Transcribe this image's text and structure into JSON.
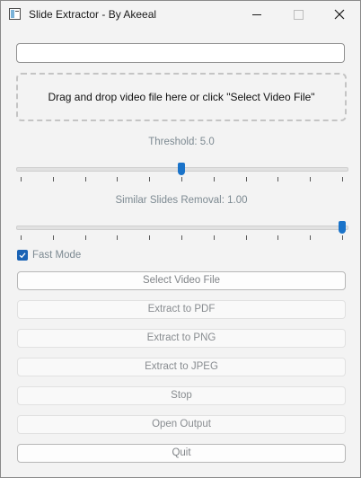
{
  "window": {
    "title": "Slide Extractor - By Akeeal",
    "app_icon": "app-window-icon"
  },
  "path_input": {
    "value": "",
    "placeholder": ""
  },
  "drop_zone": {
    "text": "Drag and drop video file here or click \"Select Video File\""
  },
  "threshold": {
    "label": "Threshold: 5.0",
    "value": 5.0,
    "min": 0,
    "max": 10,
    "ticks": 11
  },
  "similarity": {
    "label": "Similar Slides Removal: 1.00",
    "value": 1.0,
    "min": 0,
    "max": 1,
    "ticks": 11
  },
  "fast_mode": {
    "label": "Fast Mode",
    "checked": true
  },
  "buttons": {
    "select_video": "Select Video File",
    "extract_pdf": "Extract to PDF",
    "extract_png": "Extract to PNG",
    "extract_jpeg": "Extract to JPEG",
    "stop": "Stop",
    "open_output": "Open Output",
    "quit": "Quit"
  },
  "colors": {
    "accent": "#1a73c9",
    "checkbox": "#1a63b5",
    "label": "#7d8a92"
  }
}
